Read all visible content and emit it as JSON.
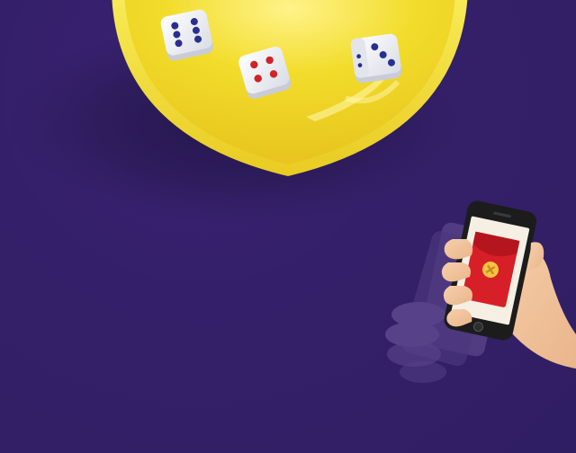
{
  "scene": {
    "background_color": "#34206a",
    "bowl": {
      "color": "#f4dd2c",
      "rim_color": "#f7e54a"
    },
    "dice": [
      {
        "name": "die-six",
        "face_value": 6,
        "pip_color": "#2a2f8f"
      },
      {
        "name": "die-four",
        "face_value": 4,
        "pip_color": "#d1232a"
      },
      {
        "name": "die-three",
        "face_value": 3,
        "pip_color": "#2a2f8f"
      }
    ],
    "phone": {
      "body_color": "#1c1c1c",
      "screen_color": "#f5efe4",
      "envelope_color": "#d71f27",
      "emblem_color": "#f6c343"
    },
    "hand": {
      "skin_color": "#f3c39a",
      "sleeve_color": "#5d4a86"
    }
  }
}
